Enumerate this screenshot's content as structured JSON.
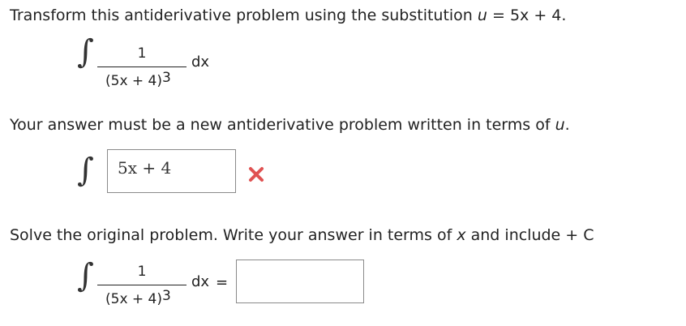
{
  "problem": {
    "instruction": "Transform this antiderivative problem using the substitution",
    "sub_var": "u",
    "sub_rhs": "= 5x + 4.",
    "numerator": "1",
    "denominator_base": "(5x + 4)",
    "denominator_exp": "3",
    "dx": "dx"
  },
  "answer_section": {
    "instruction": "Your answer must be a new antiderivative problem written in terms of",
    "var": "u",
    "period": ".",
    "input_value": "5x + 4",
    "status_icon": "x-mark-icon",
    "status_color": "#e05252"
  },
  "solve_section": {
    "instruction_a": "Solve the original problem. Write your answer in terms of",
    "var": "x",
    "instruction_b": "and include + C",
    "numerator": "1",
    "denominator_base": "(5x + 4)",
    "denominator_exp": "3",
    "dx": "dx",
    "equals": "=",
    "input_value": ""
  }
}
